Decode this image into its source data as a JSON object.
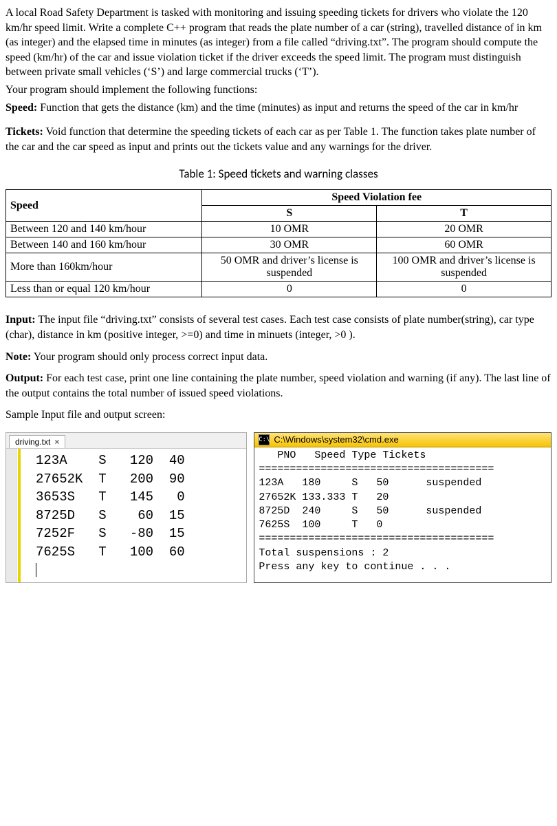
{
  "problem": {
    "p1": "A local Road Safety Department is tasked with monitoring and issuing speeding tickets for drivers who violate the 120 km/hr speed limit. Write a complete C++ program that reads the plate number of a car (string), travelled distance of in km (as integer) and the elapsed time in minutes (as integer) from a file called “driving.txt”. The program should compute the speed (km/hr) of the car and issue violation ticket if the driver exceeds the speed limit. The program must distinguish between private small vehicles (‘S’) and large commercial trucks (‘T’).",
    "p2": "Your program should implement the following functions:",
    "speed_label": "Speed:",
    "speed_text": " Function that gets the distance (km) and the time (minutes) as input and returns the speed of the car in km/hr",
    "tickets_label": "Tickets:",
    "tickets_text": " Void function that determine the speeding tickets of each car as per Table 1. The function takes plate number of the car and the car speed as input and prints out the tickets value and any warnings for the driver."
  },
  "table": {
    "caption": "Table 1: Speed tickets and warning classes",
    "head_speed": "Speed",
    "head_fee": "Speed Violation fee",
    "col_s": "S",
    "col_t": "T",
    "rows": [
      {
        "speed": "Between 120 and 140 km/hour",
        "s": "10 OMR",
        "t": "20 OMR"
      },
      {
        "speed": "Between 140 and 160 km/hour",
        "s": "30 OMR",
        "t": "60 OMR"
      },
      {
        "speed": "More than 160km/hour",
        "s": "50 OMR and driver’s license is suspended",
        "t": "100 OMR and driver’s license is suspended"
      },
      {
        "speed": "Less than or equal 120 km/hour",
        "s": "0",
        "t": "0"
      }
    ]
  },
  "io": {
    "input_label": "Input:",
    "input_text": " The input file “driving.txt” consists of several test cases. Each test case consists of plate number(string), car type (char), distance in km (positive integer, >=0) and time in minuets  (integer, >0 ).",
    "note_label": "Note:",
    "note_text": " Your program should only process correct input data.",
    "output_label": "Output:",
    "output_text": " For each test case, print one line containing the plate number, speed violation and warning (if any). The last line of the output contains the total number of issued speed violations.",
    "sample_label": "Sample Input file and output  screen:"
  },
  "editor": {
    "tab_label": "driving.txt",
    "content": "123A    S   120  40\n27652K  T   200  90\n3653S   T   145   0\n8725D   S    60  15\n7252F   S   -80  15\n7625S   T   100  60\n"
  },
  "console": {
    "title": "C:\\Windows\\system32\\cmd.exe",
    "body": "   PNO   Speed Type Tickets\n======================================\n123A   180     S   50      suspended\n27652K 133.333 T   20\n8725D  240     S   50      suspended\n7625S  100     T   0\n======================================\nTotal suspensions : 2\nPress any key to continue . . ."
  }
}
